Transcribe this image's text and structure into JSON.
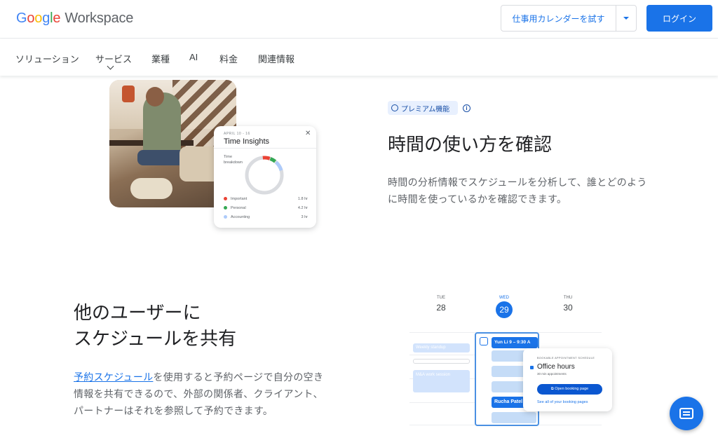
{
  "header": {
    "logo_google": [
      "G",
      "o",
      "o",
      "g",
      "l",
      "e"
    ],
    "logo_product": "Workspace",
    "trial_button": "仕事用カレンダーを試す",
    "login_button": "ログイン"
  },
  "nav": {
    "items": [
      "ソリューション",
      "サービス",
      "業種",
      "AI",
      "料金",
      "関連情報"
    ]
  },
  "feature1": {
    "badge": "プレミアム機能",
    "info_icon": "info-icon",
    "title": "時間の使い方を確認",
    "description": "時間の分析情報でスケジュールを分析して、誰とどのように時間を使っているかを確認できます。",
    "card": {
      "date_range": "APRIL 10 - 16",
      "title": "Time Insights",
      "breakdown_label": "Time breakdown",
      "legend": [
        {
          "label": "Important",
          "hours": "1.8 hr",
          "color": "#ea4335"
        },
        {
          "label": "Personal",
          "hours": "4.2 hr",
          "color": "#34a853"
        },
        {
          "label": "Accounting",
          "hours": "3 hr",
          "color": "#aecbfa"
        }
      ]
    }
  },
  "feature2": {
    "title_line1": "他のユーザーに",
    "title_line2": "スケジュールを共有",
    "link_text": "予約スケジュール",
    "description_rest": "を使用すると予約ページで自分の空き情報を共有できるので、外部の関係者、クライアント、パートナーはそれを参照して予約できます。",
    "calendar": {
      "days": [
        {
          "dow": "TUE",
          "num": "28"
        },
        {
          "dow": "WED",
          "num": "29"
        },
        {
          "dow": "THU",
          "num": "30"
        }
      ],
      "events": [
        "Weekly standup",
        "M&A work session"
      ],
      "slot_yun": "Yun Li  9 – 9:30 A",
      "slot_rucha": "Rucha Patel",
      "popup": {
        "label": "BOOKABLE APPOINTMENT SCHEDULE",
        "title": "Office hours",
        "subtitle": "30 min appointments",
        "button": "Open booking page",
        "link": "See all of your booking pages"
      }
    }
  },
  "colors": {
    "accent": "#1a73e8",
    "badge_bg": "#e8f0fe"
  }
}
